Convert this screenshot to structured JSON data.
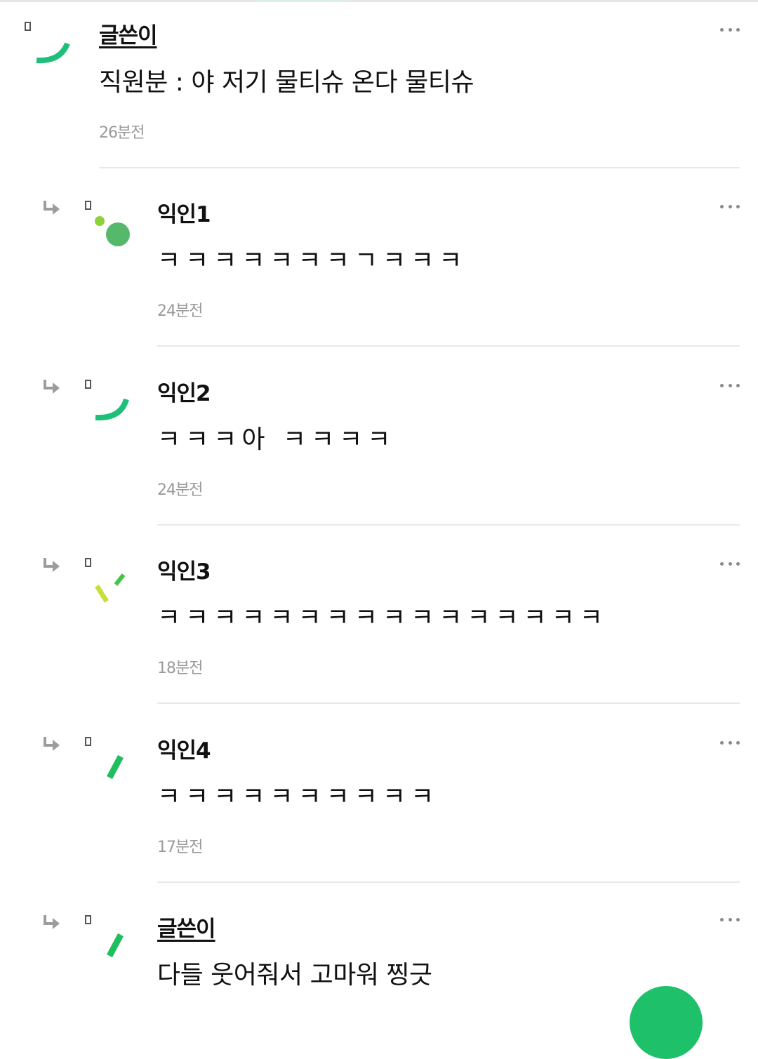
{
  "comments": [
    {
      "author": "글쓴이",
      "is_op": true,
      "text": "직원분 : 야 저기 물티슈 온다 물티슈",
      "time": "26분전"
    },
    {
      "author": "익인1",
      "is_op": false,
      "text": "ㅋㅋㅋㅋㅋㅋㅋㄱㅋㅋㅋ",
      "time": "24분전"
    },
    {
      "author": "익인2",
      "is_op": false,
      "text": "ㅋㅋㅋ아 ㅋㅋㅋㅋ",
      "time": "24분전"
    },
    {
      "author": "익인3",
      "is_op": false,
      "text": "ㅋㅋㅋㅋㅋㅋㅋㅋㅋㅋㅋㅋㅋㅋㅋㅋ",
      "time": "18분전"
    },
    {
      "author": "익인4",
      "is_op": false,
      "text": "ㅋㅋㅋㅋㅋㅋㅋㅋㅋㅋ",
      "time": "17분전"
    },
    {
      "author": "글쓴이",
      "is_op": true,
      "text": "다들 웃어줘서 고마워 찡긋",
      "time": ""
    }
  ],
  "icons": {
    "reply": "reply-arrow-icon",
    "more": "more-options-icon"
  },
  "colors": {
    "accent_green": "#1fbf7a",
    "timestamp_gray": "#9a9a9a",
    "fab_green": "#1fc06a"
  }
}
